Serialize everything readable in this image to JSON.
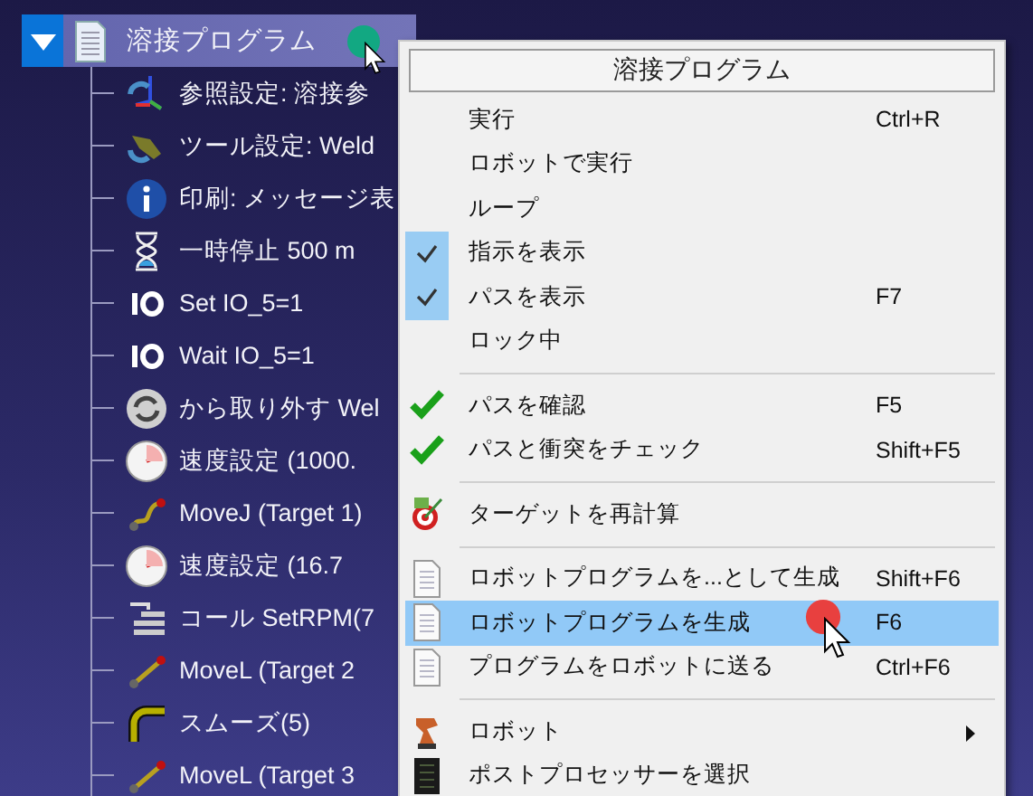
{
  "tree": {
    "root": {
      "label": "溶接プログラム",
      "expanded": true,
      "selected": true,
      "children": [
        {
          "label": "参照設定: 溶接参",
          "kind": "frame"
        },
        {
          "label": "ツール設定: Weld",
          "kind": "tool"
        },
        {
          "label": "印刷: メッセージ表",
          "kind": "info"
        },
        {
          "label": "一時停止 500 m",
          "kind": "pause"
        },
        {
          "label": "Set IO_5=1",
          "kind": "io"
        },
        {
          "label": "Wait IO_5=1",
          "kind": "io"
        },
        {
          "label": "から取り外す Wel",
          "kind": "detach"
        },
        {
          "label": "速度設定 (1000.",
          "kind": "speed"
        },
        {
          "label": "MoveJ (Target 1)",
          "kind": "movej"
        },
        {
          "label": "速度設定 (16.7",
          "kind": "speed"
        },
        {
          "label": "コール SetRPM(7",
          "kind": "call"
        },
        {
          "label": "MoveL (Target 2",
          "kind": "movel"
        },
        {
          "label": "スムーズ(5)",
          "kind": "smooth"
        },
        {
          "label": "MoveL (Target 3",
          "kind": "movel"
        }
      ]
    }
  },
  "context_menu": {
    "title": "溶接プログラム",
    "groups": [
      [
        {
          "label": "実行",
          "shortcut": "Ctrl+R",
          "kind": "plain",
          "selected": false,
          "submenu": false
        },
        {
          "label": "ロボットで実行",
          "kind": "plain",
          "selected": false,
          "submenu": false
        },
        {
          "label": "ループ",
          "kind": "plain",
          "selected": false,
          "submenu": false
        },
        {
          "label": "指示を表示",
          "kind": "toggle",
          "checked": true,
          "selected": false,
          "submenu": false
        },
        {
          "label": "パスを表示",
          "shortcut": "F7",
          "kind": "toggle",
          "checked": true,
          "selected": false,
          "submenu": false
        },
        {
          "label": "ロック中",
          "kind": "plain",
          "selected": false,
          "submenu": false
        }
      ],
      [
        {
          "label": "パスを確認",
          "shortcut": "F5",
          "kind": "verify",
          "selected": false,
          "submenu": false
        },
        {
          "label": "パスと衝突をチェック",
          "shortcut": "Shift+F5",
          "kind": "verify",
          "selected": false,
          "submenu": false
        }
      ],
      [
        {
          "label": "ターゲットを再計算",
          "kind": "target",
          "selected": false,
          "submenu": false
        }
      ],
      [
        {
          "label": "ロボットプログラムを...として生成",
          "shortcut": "Shift+F6",
          "kind": "file",
          "selected": false,
          "submenu": false
        },
        {
          "label": "ロボットプログラムを生成",
          "shortcut": "F6",
          "kind": "file",
          "selected": true,
          "submenu": false
        },
        {
          "label": "プログラムをロボットに送る",
          "shortcut": "Ctrl+F6",
          "kind": "file",
          "selected": false,
          "submenu": false
        }
      ],
      [
        {
          "label": "ロボット",
          "kind": "robot",
          "selected": false,
          "submenu": true
        },
        {
          "label": "ポストプロセッサーを選択",
          "kind": "post",
          "selected": false,
          "submenu": false
        }
      ]
    ]
  }
}
